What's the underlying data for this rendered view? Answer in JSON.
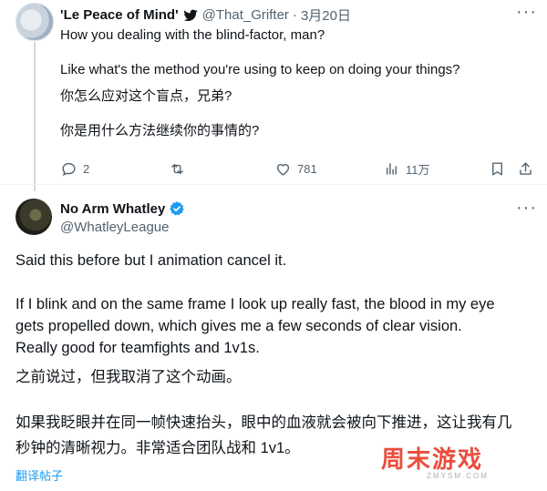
{
  "tweet1": {
    "display_name": "'Le Peace of Mind'",
    "handle": "@That_Grifter",
    "separator": "·",
    "date": "3月20日",
    "line1": "How you dealing with the blind-factor, man?",
    "line2": "Like what's the method you're using to keep on doing your things?",
    "line3": "你怎么应对这个盲点，兄弟?",
    "line4": "你是用什么方法继续你的事情的?",
    "more": "···",
    "actions": {
      "reply_count": "2",
      "like_count": "781",
      "views_count": "11万"
    }
  },
  "tweet2": {
    "display_name": "No Arm Whatley",
    "handle": "@WhatleyLeague",
    "more": "···",
    "para1": "Said this before but I animation cancel it.",
    "para2_line1": "If I blink and on the same frame I look up really fast, the blood in my eye",
    "para2_line2": "gets propelled down, which gives me a few seconds of clear vision.",
    "para2_line3": "Really good for teamfights and 1v1s.",
    "zh1": "之前说过，但我取消了这个动画。",
    "zh2_line1": "如果我眨眼并在同一帧快速抬头，眼中的血液就会被向下推进，这让我有几",
    "zh2_line2": "秒钟的清晰视力。非常适合团队战和 1v1。",
    "translate_label": "翻译帖子"
  },
  "watermark": {
    "text": "周末游戏",
    "url": "ZMYSM.COM"
  },
  "colors": {
    "verified": "#1d9bf0",
    "link": "#1d9bf0",
    "muted": "#536471",
    "watermark": "#e94e3c"
  }
}
